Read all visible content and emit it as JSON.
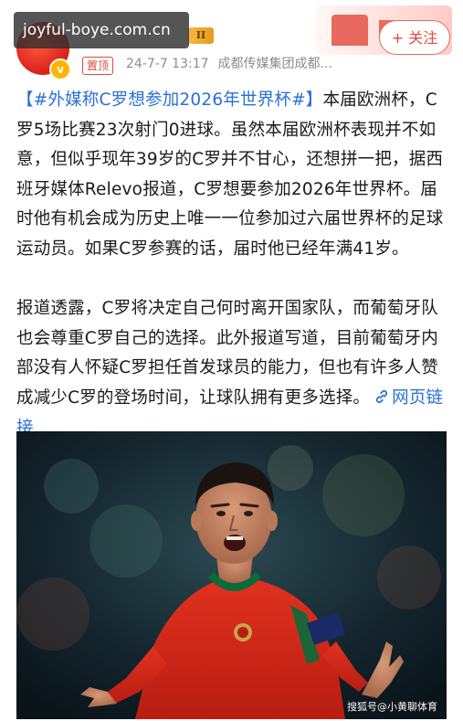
{
  "watermark": {
    "site": "joyful-boye.com.cn"
  },
  "header": {
    "level_badge": "II",
    "follow_label": "+ 关注",
    "pin_tag": "置顶",
    "date": "24-7-7 13:17",
    "source": "成都传媒集团成都..."
  },
  "post": {
    "hashtag": "【#外媒称C罗想参加2026年世界杯#】",
    "para1_text": "本届欧洲杯，C罗5场比赛23次射门0进球。虽然本届欧洲杯表现并不如意，但似乎现年39岁的C罗并不甘心，还想拼一把，据西班牙媒体Relevo报道，C罗想要参加2026年世界杯。届时他有机会成为历史上唯一一位参加过六届世界杯的足球运动员。如果C罗参赛的话，届时他已经年满41岁。",
    "para2_text": "报道透露，C罗将决定自己何时离开国家队，而葡萄牙队也会尊重C罗自己的选择。此外报道写道，目前葡萄牙内部没有人怀疑C罗担任首发球员的能力，但也有许多人赞成减少C罗的登场时间，让球队拥有更多选择。",
    "link_label": "网页链接"
  },
  "photo": {
    "watermark": "搜狐号@小黄聊体育"
  },
  "colors": {
    "link": "#2a6fd6",
    "accent_red": "#e0483a",
    "jersey_red": "#d52b1e",
    "jersey_green": "#0a6b3a"
  }
}
